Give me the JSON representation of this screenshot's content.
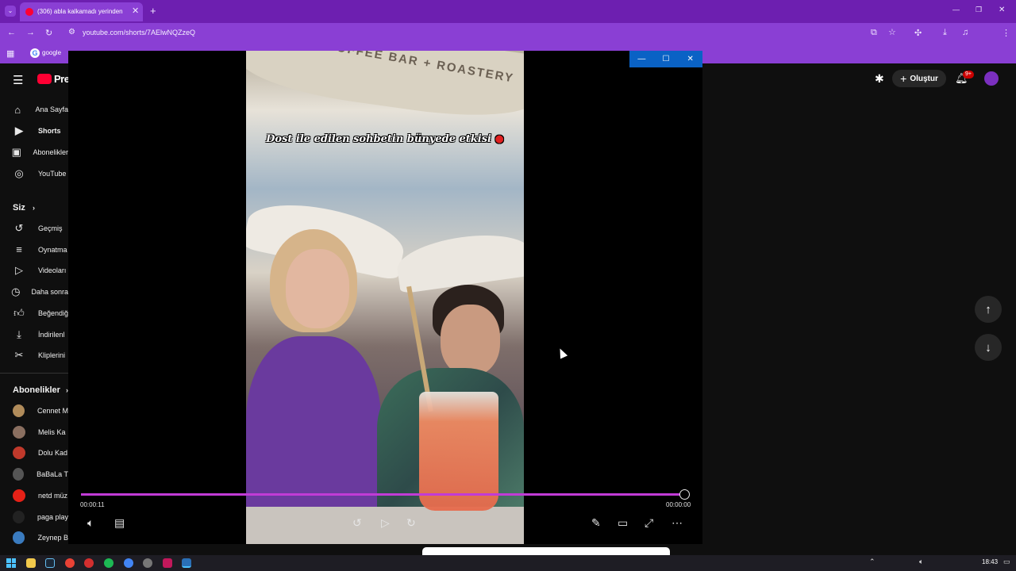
{
  "browser": {
    "tab_title": "(306) abla kalkamadı yerinden",
    "url": "youtube.com/shorts/7AElwNQZzeQ",
    "bookmark_google": "google",
    "colors": {
      "chrome": "#6d1fb0",
      "chrome_light": "#8a3fd4"
    }
  },
  "youtube": {
    "logo_text": "Pre",
    "create_label": "Oluştur",
    "notif_count": "9+",
    "sidebar": {
      "main": [
        {
          "label": "Ana Sayfa",
          "icon": "home-icon"
        },
        {
          "label": "Shorts",
          "icon": "shorts-icon"
        },
        {
          "label": "Abonelikler",
          "icon": "subscriptions-icon"
        },
        {
          "label": "YouTube",
          "icon": "youtube-music-icon"
        }
      ],
      "you_header": "Siz",
      "you": [
        {
          "label": "Geçmiş",
          "icon": "history-icon"
        },
        {
          "label": "Oynatma",
          "icon": "playlist-icon"
        },
        {
          "label": "Videoları",
          "icon": "your-videos-icon"
        },
        {
          "label": "Daha sonra",
          "icon": "watch-later-icon"
        },
        {
          "label": "Beğendiğ",
          "icon": "like-icon"
        },
        {
          "label": "İndirilenl",
          "icon": "download-icon"
        },
        {
          "label": "Kliplerini",
          "icon": "scissors-icon"
        }
      ],
      "subs_header": "Abonelikler",
      "subs": [
        {
          "label": "Cennet M",
          "color": "#b08b5a"
        },
        {
          "label": "Melis Ka",
          "color": "#8a6f60"
        },
        {
          "label": "Dolu Kad",
          "color": "#c0392b"
        },
        {
          "label": "BaBaLa T",
          "color": "#555555"
        },
        {
          "label": "netd müz",
          "color": "#e62117"
        },
        {
          "label": "paga play",
          "color": "#222222"
        },
        {
          "label": "Zeynep B",
          "color": "#3a7bbf"
        }
      ]
    }
  },
  "player": {
    "caption": "Dost ile edilen sohbetin bünyede etkisi",
    "sign_text": "COFFEE BAR + ROASTERY",
    "time_current": "00:00:11",
    "time_total": "00:00:00",
    "progress": 1.0,
    "accent": "#c13bd6"
  },
  "taskbar": {
    "time": "18:43"
  }
}
